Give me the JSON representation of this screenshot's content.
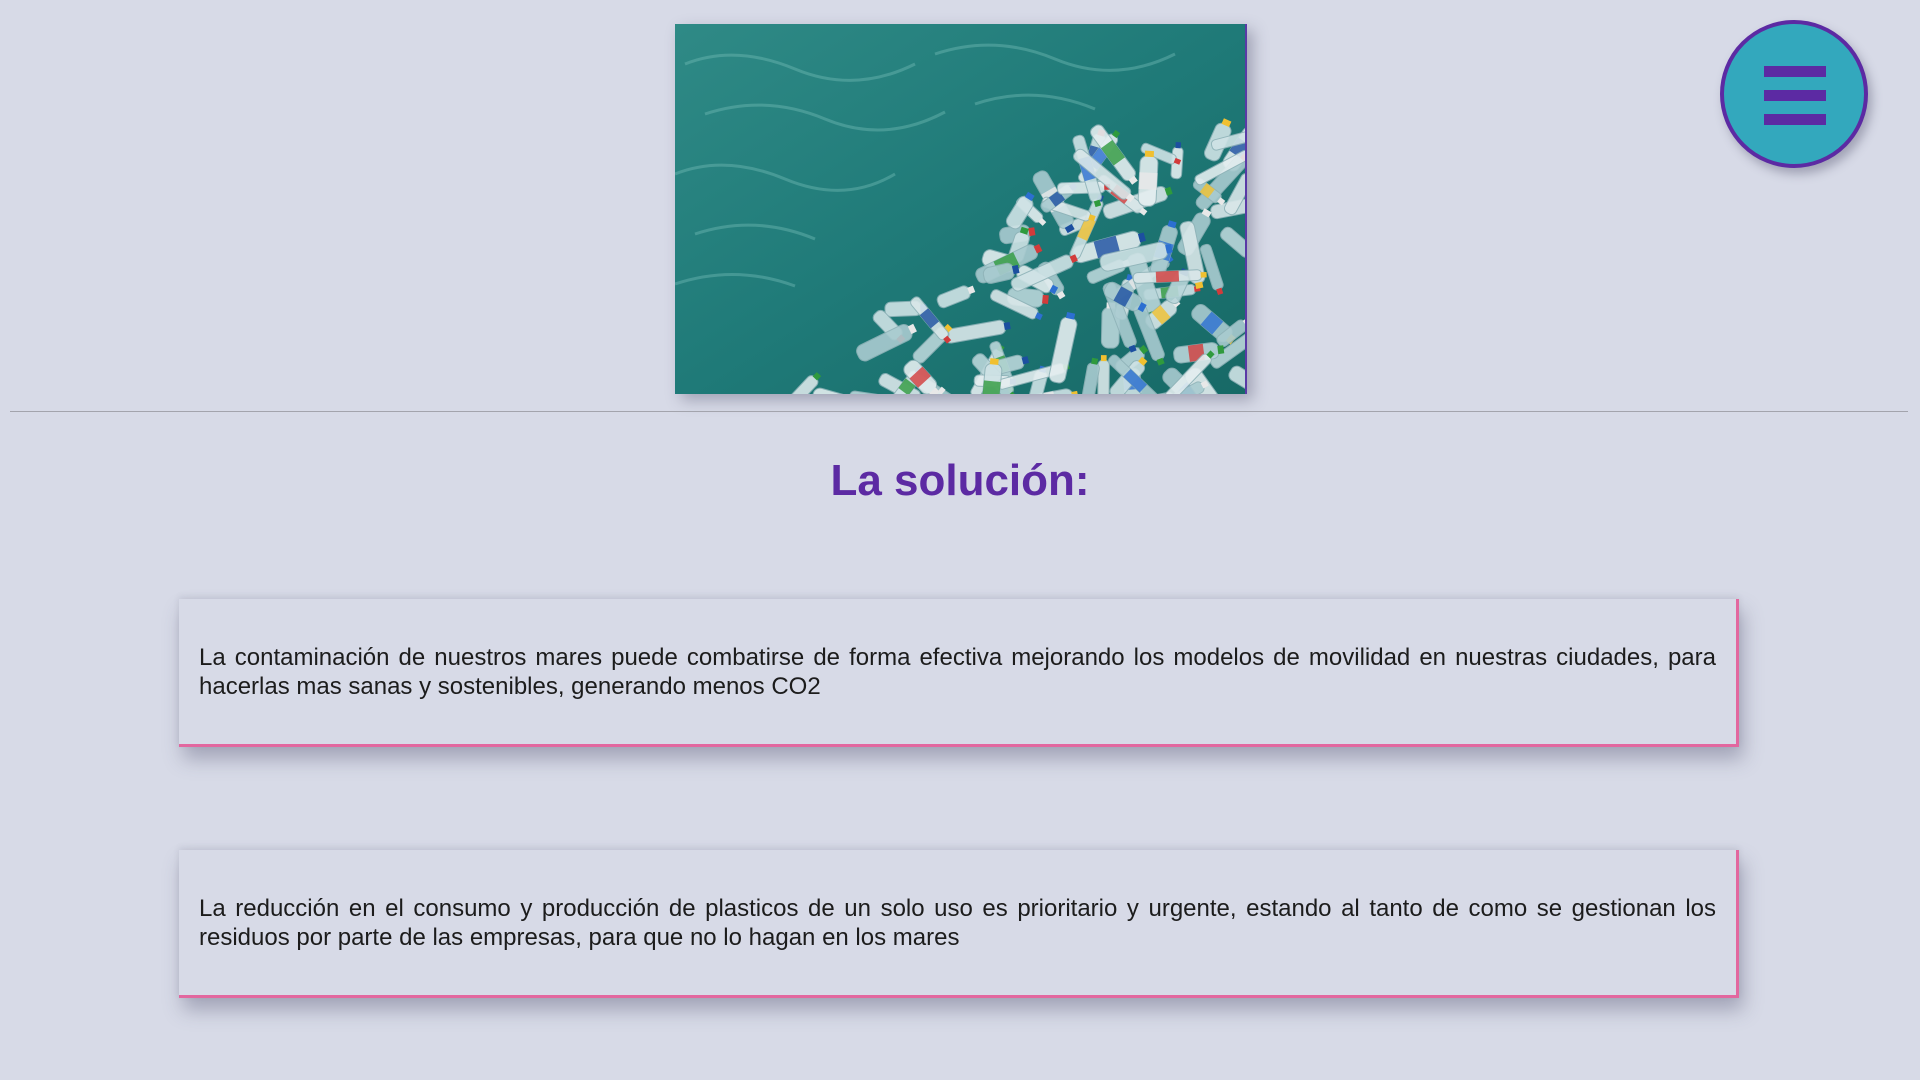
{
  "hero": {
    "alt": "Botellas de plástico flotando en el mar"
  },
  "section": {
    "title": "La solución:"
  },
  "cards": [
    {
      "text": "La contaminación de nuestros mares puede combatirse de forma efectiva mejorando los modelos de movilidad en nuestras ciudades, para hacerlas mas sanas y sostenibles, generando menos CO2"
    },
    {
      "text": "La reducción en el consumo y producción de plasticos de un solo uso es prioritario y urgente, estando al tanto de como se gestionan los residuos por parte de las empresas, para que no lo hagan en los mares"
    }
  ],
  "menu": {
    "icon": "hamburger-menu-icon"
  },
  "colors": {
    "background": "#d7dae7",
    "title": "#5c2aa3",
    "card_accent": "#e2679f",
    "menu_fill": "#33a8bd",
    "menu_border": "#5c2aa3"
  }
}
